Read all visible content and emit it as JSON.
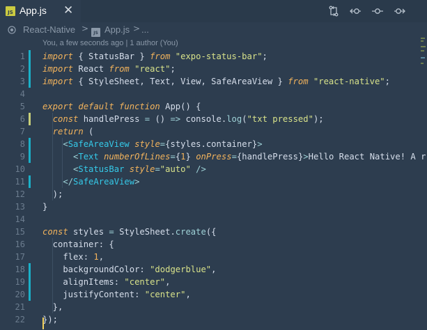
{
  "tab": {
    "badge": "JS",
    "label": "App.js",
    "close": "✕"
  },
  "toolbar": {
    "icons": [
      "compare-changes-icon",
      "go-back-icon",
      "timeline-icon",
      "go-forward-icon"
    ]
  },
  "breadcrumb": {
    "root": "React-Native",
    "separator": ">",
    "file_badge": "JS",
    "file": "App.js",
    "ellipsis": "..."
  },
  "blame": "You, a few seconds ago | 1 author (You)",
  "lines": [
    {
      "num": "1",
      "mark": "added",
      "tokens": [
        [
          "kw",
          "import"
        ],
        [
          "plain",
          " { StatusBar } "
        ],
        [
          "kw",
          "from"
        ],
        [
          "plain",
          " "
        ],
        [
          "str",
          "\"expo-status-bar\""
        ],
        [
          "plain",
          ";"
        ]
      ]
    },
    {
      "num": "2",
      "mark": "added",
      "tokens": [
        [
          "kw",
          "import"
        ],
        [
          "plain",
          " React "
        ],
        [
          "kw",
          "from"
        ],
        [
          "plain",
          " "
        ],
        [
          "str",
          "\"react\""
        ],
        [
          "plain",
          ";"
        ]
      ]
    },
    {
      "num": "3",
      "mark": "added",
      "tokens": [
        [
          "kw",
          "import"
        ],
        [
          "plain",
          " { StyleSheet, Text, View, SafeAreaView } "
        ],
        [
          "kw",
          "from"
        ],
        [
          "plain",
          " "
        ],
        [
          "str",
          "\"react-native\""
        ],
        [
          "plain",
          ";"
        ]
      ]
    },
    {
      "num": "4",
      "mark": "",
      "tokens": []
    },
    {
      "num": "5",
      "mark": "",
      "tokens": [
        [
          "kw",
          "export default function"
        ],
        [
          "plain",
          " App() {"
        ]
      ]
    },
    {
      "num": "6",
      "mark": "modified",
      "tokens": [
        [
          "plain",
          "  "
        ],
        [
          "kw",
          "const"
        ],
        [
          "plain",
          " handlePress "
        ],
        [
          "punc",
          "="
        ],
        [
          "plain",
          " () "
        ],
        [
          "punc",
          "=>"
        ],
        [
          "plain",
          " console."
        ],
        [
          "method",
          "log"
        ],
        [
          "plain",
          "("
        ],
        [
          "str",
          "\"txt pressed\""
        ],
        [
          "plain",
          ");"
        ]
      ]
    },
    {
      "num": "7",
      "mark": "",
      "tokens": [
        [
          "plain",
          "  "
        ],
        [
          "kw",
          "return"
        ],
        [
          "plain",
          " ("
        ]
      ]
    },
    {
      "num": "8",
      "mark": "added",
      "tokens": [
        [
          "plain",
          "    "
        ],
        [
          "punc",
          "<"
        ],
        [
          "tag",
          "SafeAreaView"
        ],
        [
          "plain",
          " "
        ],
        [
          "attr",
          "style"
        ],
        [
          "punc",
          "="
        ],
        [
          "plain",
          "{styles.container}"
        ],
        [
          "punc",
          ">"
        ]
      ]
    },
    {
      "num": "9",
      "mark": "added",
      "tokens": [
        [
          "plain",
          "      "
        ],
        [
          "punc",
          "<"
        ],
        [
          "tag",
          "Text"
        ],
        [
          "plain",
          " "
        ],
        [
          "attr",
          "numberOfLines"
        ],
        [
          "punc",
          "="
        ],
        [
          "plain",
          "{"
        ],
        [
          "num",
          "1"
        ],
        [
          "plain",
          "} "
        ],
        [
          "attr",
          "onPress"
        ],
        [
          "punc",
          "="
        ],
        [
          "plain",
          "{handlePress}"
        ],
        [
          "punc",
          ">"
        ],
        [
          "plain",
          "Hello React Native! A r"
        ]
      ]
    },
    {
      "num": "10",
      "mark": "",
      "tokens": [
        [
          "plain",
          "      "
        ],
        [
          "punc",
          "<"
        ],
        [
          "tag",
          "StatusBar"
        ],
        [
          "plain",
          " "
        ],
        [
          "attr",
          "style"
        ],
        [
          "punc",
          "="
        ],
        [
          "str",
          "\"auto\""
        ],
        [
          "plain",
          " "
        ],
        [
          "punc",
          "/>"
        ]
      ]
    },
    {
      "num": "11",
      "mark": "added",
      "tokens": [
        [
          "plain",
          "    "
        ],
        [
          "punc",
          "</"
        ],
        [
          "tag",
          "SafeAreaView"
        ],
        [
          "punc",
          ">"
        ]
      ]
    },
    {
      "num": "12",
      "mark": "",
      "tokens": [
        [
          "plain",
          "  );"
        ]
      ]
    },
    {
      "num": "13",
      "mark": "",
      "tokens": [
        [
          "plain",
          "}"
        ]
      ]
    },
    {
      "num": "14",
      "mark": "",
      "tokens": []
    },
    {
      "num": "15",
      "mark": "",
      "tokens": [
        [
          "kw",
          "const"
        ],
        [
          "plain",
          " styles "
        ],
        [
          "punc",
          "="
        ],
        [
          "plain",
          " StyleSheet."
        ],
        [
          "method",
          "create"
        ],
        [
          "plain",
          "({"
        ]
      ]
    },
    {
      "num": "16",
      "mark": "",
      "tokens": [
        [
          "plain",
          "  container: {"
        ]
      ]
    },
    {
      "num": "17",
      "mark": "",
      "tokens": [
        [
          "plain",
          "    flex: "
        ],
        [
          "num",
          "1"
        ],
        [
          "plain",
          ","
        ]
      ]
    },
    {
      "num": "18",
      "mark": "added",
      "tokens": [
        [
          "plain",
          "    backgroundColor: "
        ],
        [
          "str",
          "\"dodgerblue\""
        ],
        [
          "plain",
          ","
        ]
      ]
    },
    {
      "num": "19",
      "mark": "added",
      "tokens": [
        [
          "plain",
          "    alignItems: "
        ],
        [
          "str",
          "\"center\""
        ],
        [
          "plain",
          ","
        ]
      ]
    },
    {
      "num": "20",
      "mark": "added",
      "tokens": [
        [
          "plain",
          "    justifyContent: "
        ],
        [
          "str",
          "\"center\""
        ],
        [
          "plain",
          ","
        ]
      ]
    },
    {
      "num": "21",
      "mark": "",
      "tokens": [
        [
          "plain",
          "  },"
        ]
      ]
    },
    {
      "num": "22",
      "mark": "",
      "tokens": [
        [
          "plain",
          "});"
        ]
      ]
    }
  ],
  "colors": {
    "background": "#2d3d4f",
    "keyword": "#f2b35c",
    "string": "#d8e28a",
    "tag": "#35c9e8",
    "added_marker": "#1ab0c8",
    "modified_marker": "#c7cf7a"
  }
}
